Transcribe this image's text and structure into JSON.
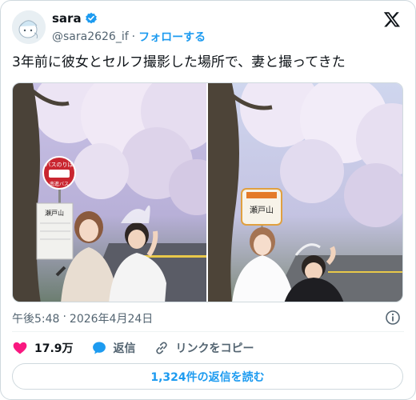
{
  "author": {
    "display_name": "sara",
    "handle": "@sara2626_if",
    "separator": "·",
    "follow_label": "フォローする"
  },
  "icons": {
    "avatar": "avatar-illustration",
    "verified": "verified-badge-icon",
    "brand": "x-logo-icon",
    "info": "info-icon",
    "like": "heart-icon",
    "reply": "speech-bubble-icon",
    "link": "link-icon"
  },
  "tweet": {
    "text": "3年前に彼女とセルフ撮影した場所で、妻と撮ってきた"
  },
  "photos": [
    {
      "sign_top": "バスのりば",
      "sign_company": "南進バス",
      "sign_stop": "瀬戸山"
    },
    {
      "sign_stop": "瀬戸山"
    }
  ],
  "meta": {
    "time": "午後5:48",
    "separator": "·",
    "date": "2026年4月24日"
  },
  "actions": {
    "likes_count": "17.9万",
    "reply_label": "返信",
    "copy_link_label": "リンクをコピー"
  },
  "replies_button": "1,324件の返信を読む",
  "colors": {
    "accent": "#1d9bf0",
    "like": "#f91880",
    "text": "#0f1419",
    "muted": "#536471",
    "border": "#cfd9de"
  }
}
